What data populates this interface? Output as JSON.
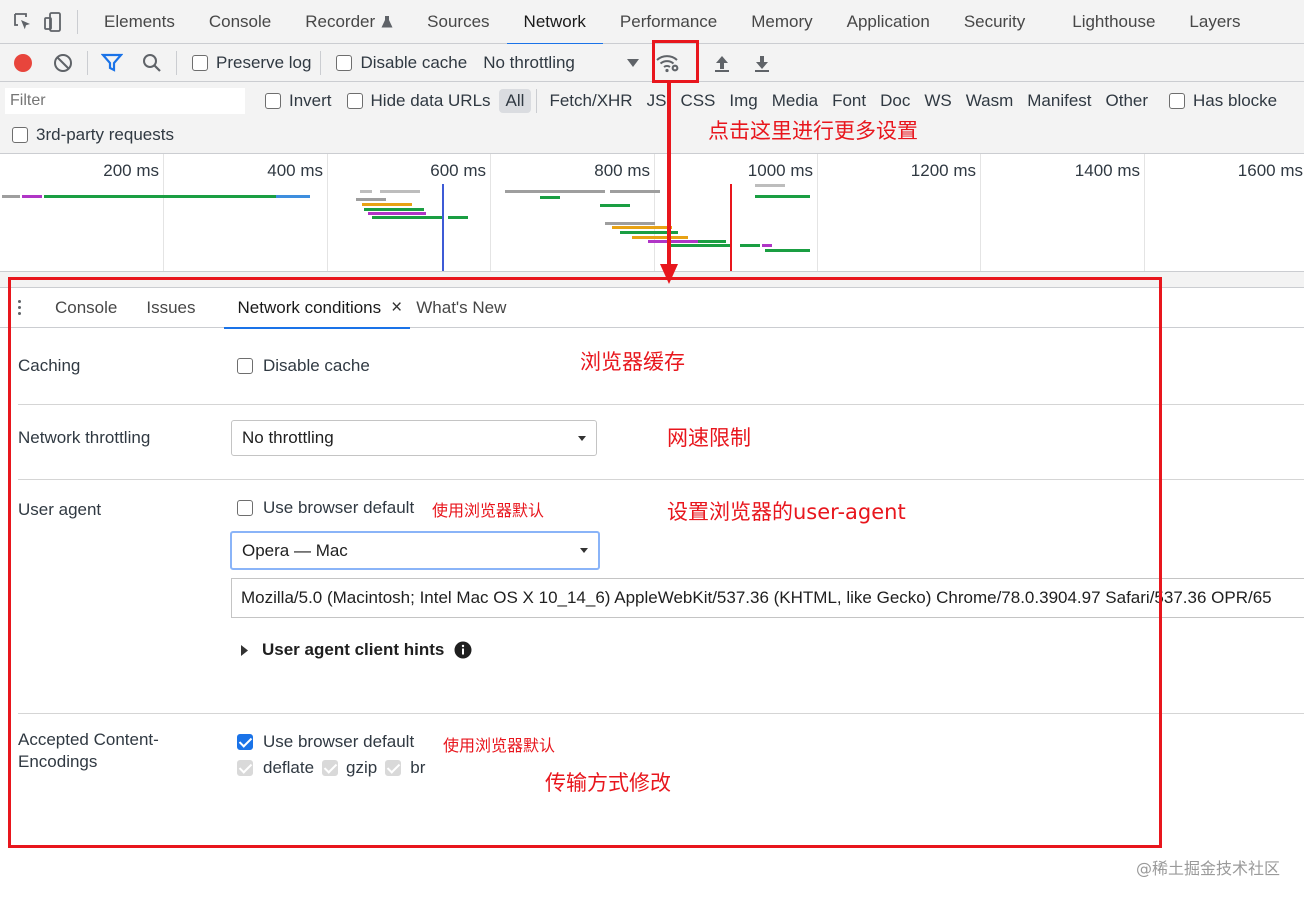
{
  "main_tabs": [
    "Elements",
    "Console",
    "Recorder",
    "Sources",
    "Network",
    "Performance",
    "Memory",
    "Application",
    "Security",
    "Lighthouse",
    "Layers"
  ],
  "active_main_tab": "Network",
  "toolbar": {
    "preserve_log": "Preserve log",
    "disable_cache": "Disable cache",
    "throttling": "No throttling"
  },
  "filter": {
    "placeholder": "Filter",
    "invert": "Invert",
    "hide_data_urls": "Hide data URLs",
    "types": [
      "All",
      "Fetch/XHR",
      "JS",
      "CSS",
      "Img",
      "Media",
      "Font",
      "Doc",
      "WS",
      "Wasm",
      "Manifest",
      "Other"
    ],
    "active_type": "All",
    "has_blocked": "Has blocke",
    "third_party": "3rd-party requests"
  },
  "timeline": {
    "ticks": [
      "200 ms",
      "400 ms",
      "600 ms",
      "800 ms",
      "1000 ms",
      "1200 ms",
      "1400 ms",
      "1600 ms"
    ]
  },
  "drawer": {
    "tabs": [
      "Console",
      "Issues",
      "Network conditions",
      "What's New"
    ],
    "active_tab": "Network conditions",
    "close_glyph": "×"
  },
  "conditions": {
    "caching_label": "Caching",
    "disable_cache": "Disable cache",
    "throttling_label": "Network throttling",
    "throttling_value": "No throttling",
    "ua_label": "User agent",
    "ua_use_default": "Use browser default",
    "ua_select_value": "Opera — Mac",
    "ua_string": "Mozilla/5.0 (Macintosh; Intel Mac OS X 10_14_6) AppleWebKit/537.36 (KHTML, like Gecko) Chrome/78.0.3904.97 Safari/537.36 OPR/65",
    "ua_hints": "User agent client hints",
    "encodings_label_1": "Accepted Content-",
    "encodings_label_2": "Encodings",
    "enc_use_default": "Use browser default",
    "enc_deflate": "deflate",
    "enc_gzip": "gzip",
    "enc_br": "br"
  },
  "annotations": {
    "click_more_settings": "点击这里进行更多设置",
    "browser_cache": "浏览器缓存",
    "speed_limit": "网速限制",
    "set_user_agent": "设置浏览器的user-agent",
    "use_default_1": "使用浏览器默认",
    "use_default_2": "使用浏览器默认",
    "transfer_mode": "传输方式修改"
  },
  "watermark": "@稀土掘金技术社区",
  "colors": {
    "annotation_red": "#e8161d",
    "accent_blue": "#1a73e8",
    "record_red": "#e8453c"
  }
}
